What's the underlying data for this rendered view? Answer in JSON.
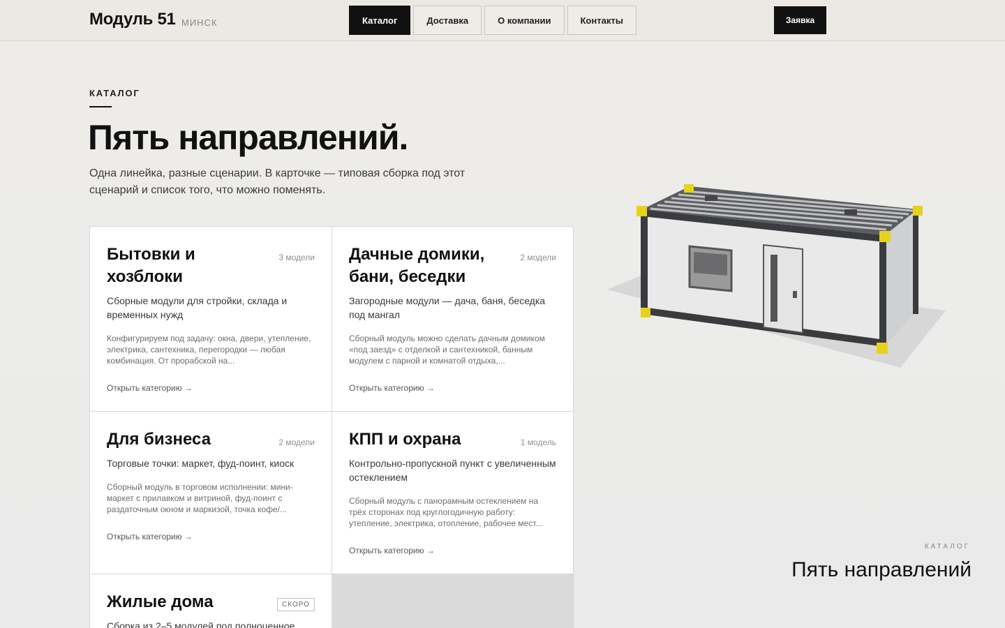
{
  "header": {
    "logo": "Модуль 51",
    "city": "минск",
    "nav": [
      {
        "label": "Каталог",
        "active": true
      },
      {
        "label": "Доставка",
        "active": false
      },
      {
        "label": "О компании",
        "active": false
      },
      {
        "label": "Контакты",
        "active": false
      }
    ],
    "cta_label": "Заявка"
  },
  "intro": {
    "eyebrow": "КАТАЛОГ",
    "title": "Пять направлений.",
    "lead": "Одна линейка, разные сценарии. В карточке — типовая сборка под этот сценарий и список того, что можно поменять."
  },
  "cards": [
    {
      "title": "Бытовки и хозблоки",
      "count": "3 модели",
      "desc": "Сборные модули для стройки, склада и временных нужд",
      "text": "Конфигурируем под задачу: окна, двери, утепление, электрика, сантехника, перегородки — любая комбинация. От прорабской на...",
      "link": "Открыть категорию →"
    },
    {
      "title": "Дачные домики, бани, беседки",
      "count": "2 модели",
      "desc": "Загородные модули — дача, баня, беседка под мангал",
      "text": "Сборный модуль можно сделать дачным домиком «под заезд» с отделкой и сантехникой, банным модулем с парной и комнатой отдыха,...",
      "link": "Открыть категорию →"
    },
    {
      "title": "Для бизнеса",
      "count": "2 модели",
      "desc": "Торговые точки: маркет, фуд-поинт, киоск",
      "text": "Сборный модуль в торговом исполнении: мини-маркет с прилавком и витриной, фуд-поинт с раздаточным окном и маркизой, точка кофе/...",
      "link": "Открыть категорию →"
    },
    {
      "title": "КПП и охрана",
      "count": "1 модель",
      "desc": "Контрольно-пропускной пункт с увеличенным остеклением",
      "text": "Сборный модуль с панорамным остеклением на трёх сторонах под круглогодичную работу: утепление, электрика, отопление, рабочее мест...",
      "link": "Открыть категорию →"
    },
    {
      "title": "Жилые дома",
      "badge": "СКОРО",
      "desc": "Сборка из 2–5 модулей под полноценное"
    }
  ],
  "side": {
    "eyebrow": "КАТАЛОГ",
    "title": "Пять направлений"
  },
  "colors": {
    "accent": "#111111",
    "corner_yellow": "#e6d21a",
    "frame": "#3a3b3e"
  }
}
